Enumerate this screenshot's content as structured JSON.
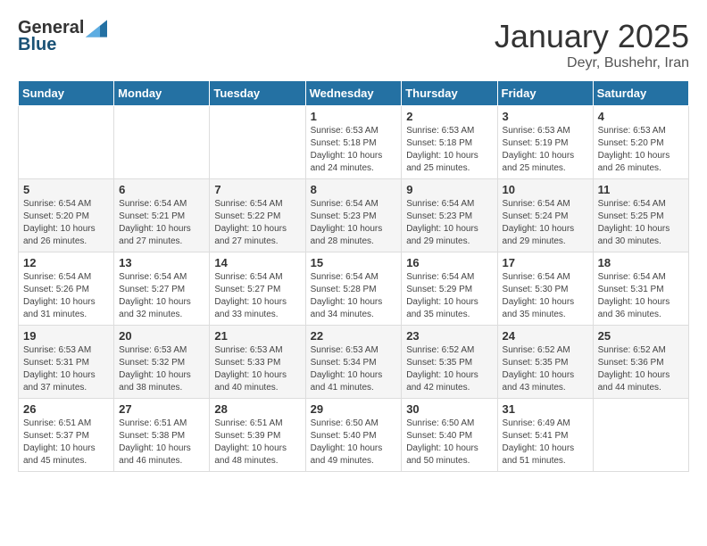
{
  "header": {
    "logo_general": "General",
    "logo_blue": "Blue",
    "month_title": "January 2025",
    "location": "Deyr, Bushehr, Iran"
  },
  "days_of_week": [
    "Sunday",
    "Monday",
    "Tuesday",
    "Wednesday",
    "Thursday",
    "Friday",
    "Saturday"
  ],
  "weeks": [
    [
      {
        "day": "",
        "info": ""
      },
      {
        "day": "",
        "info": ""
      },
      {
        "day": "",
        "info": ""
      },
      {
        "day": "1",
        "info": "Sunrise: 6:53 AM\nSunset: 5:18 PM\nDaylight: 10 hours\nand 24 minutes."
      },
      {
        "day": "2",
        "info": "Sunrise: 6:53 AM\nSunset: 5:18 PM\nDaylight: 10 hours\nand 25 minutes."
      },
      {
        "day": "3",
        "info": "Sunrise: 6:53 AM\nSunset: 5:19 PM\nDaylight: 10 hours\nand 25 minutes."
      },
      {
        "day": "4",
        "info": "Sunrise: 6:53 AM\nSunset: 5:20 PM\nDaylight: 10 hours\nand 26 minutes."
      }
    ],
    [
      {
        "day": "5",
        "info": "Sunrise: 6:54 AM\nSunset: 5:20 PM\nDaylight: 10 hours\nand 26 minutes."
      },
      {
        "day": "6",
        "info": "Sunrise: 6:54 AM\nSunset: 5:21 PM\nDaylight: 10 hours\nand 27 minutes."
      },
      {
        "day": "7",
        "info": "Sunrise: 6:54 AM\nSunset: 5:22 PM\nDaylight: 10 hours\nand 27 minutes."
      },
      {
        "day": "8",
        "info": "Sunrise: 6:54 AM\nSunset: 5:23 PM\nDaylight: 10 hours\nand 28 minutes."
      },
      {
        "day": "9",
        "info": "Sunrise: 6:54 AM\nSunset: 5:23 PM\nDaylight: 10 hours\nand 29 minutes."
      },
      {
        "day": "10",
        "info": "Sunrise: 6:54 AM\nSunset: 5:24 PM\nDaylight: 10 hours\nand 29 minutes."
      },
      {
        "day": "11",
        "info": "Sunrise: 6:54 AM\nSunset: 5:25 PM\nDaylight: 10 hours\nand 30 minutes."
      }
    ],
    [
      {
        "day": "12",
        "info": "Sunrise: 6:54 AM\nSunset: 5:26 PM\nDaylight: 10 hours\nand 31 minutes."
      },
      {
        "day": "13",
        "info": "Sunrise: 6:54 AM\nSunset: 5:27 PM\nDaylight: 10 hours\nand 32 minutes."
      },
      {
        "day": "14",
        "info": "Sunrise: 6:54 AM\nSunset: 5:27 PM\nDaylight: 10 hours\nand 33 minutes."
      },
      {
        "day": "15",
        "info": "Sunrise: 6:54 AM\nSunset: 5:28 PM\nDaylight: 10 hours\nand 34 minutes."
      },
      {
        "day": "16",
        "info": "Sunrise: 6:54 AM\nSunset: 5:29 PM\nDaylight: 10 hours\nand 35 minutes."
      },
      {
        "day": "17",
        "info": "Sunrise: 6:54 AM\nSunset: 5:30 PM\nDaylight: 10 hours\nand 35 minutes."
      },
      {
        "day": "18",
        "info": "Sunrise: 6:54 AM\nSunset: 5:31 PM\nDaylight: 10 hours\nand 36 minutes."
      }
    ],
    [
      {
        "day": "19",
        "info": "Sunrise: 6:53 AM\nSunset: 5:31 PM\nDaylight: 10 hours\nand 37 minutes."
      },
      {
        "day": "20",
        "info": "Sunrise: 6:53 AM\nSunset: 5:32 PM\nDaylight: 10 hours\nand 38 minutes."
      },
      {
        "day": "21",
        "info": "Sunrise: 6:53 AM\nSunset: 5:33 PM\nDaylight: 10 hours\nand 40 minutes."
      },
      {
        "day": "22",
        "info": "Sunrise: 6:53 AM\nSunset: 5:34 PM\nDaylight: 10 hours\nand 41 minutes."
      },
      {
        "day": "23",
        "info": "Sunrise: 6:52 AM\nSunset: 5:35 PM\nDaylight: 10 hours\nand 42 minutes."
      },
      {
        "day": "24",
        "info": "Sunrise: 6:52 AM\nSunset: 5:35 PM\nDaylight: 10 hours\nand 43 minutes."
      },
      {
        "day": "25",
        "info": "Sunrise: 6:52 AM\nSunset: 5:36 PM\nDaylight: 10 hours\nand 44 minutes."
      }
    ],
    [
      {
        "day": "26",
        "info": "Sunrise: 6:51 AM\nSunset: 5:37 PM\nDaylight: 10 hours\nand 45 minutes."
      },
      {
        "day": "27",
        "info": "Sunrise: 6:51 AM\nSunset: 5:38 PM\nDaylight: 10 hours\nand 46 minutes."
      },
      {
        "day": "28",
        "info": "Sunrise: 6:51 AM\nSunset: 5:39 PM\nDaylight: 10 hours\nand 48 minutes."
      },
      {
        "day": "29",
        "info": "Sunrise: 6:50 AM\nSunset: 5:40 PM\nDaylight: 10 hours\nand 49 minutes."
      },
      {
        "day": "30",
        "info": "Sunrise: 6:50 AM\nSunset: 5:40 PM\nDaylight: 10 hours\nand 50 minutes."
      },
      {
        "day": "31",
        "info": "Sunrise: 6:49 AM\nSunset: 5:41 PM\nDaylight: 10 hours\nand 51 minutes."
      },
      {
        "day": "",
        "info": ""
      }
    ]
  ]
}
